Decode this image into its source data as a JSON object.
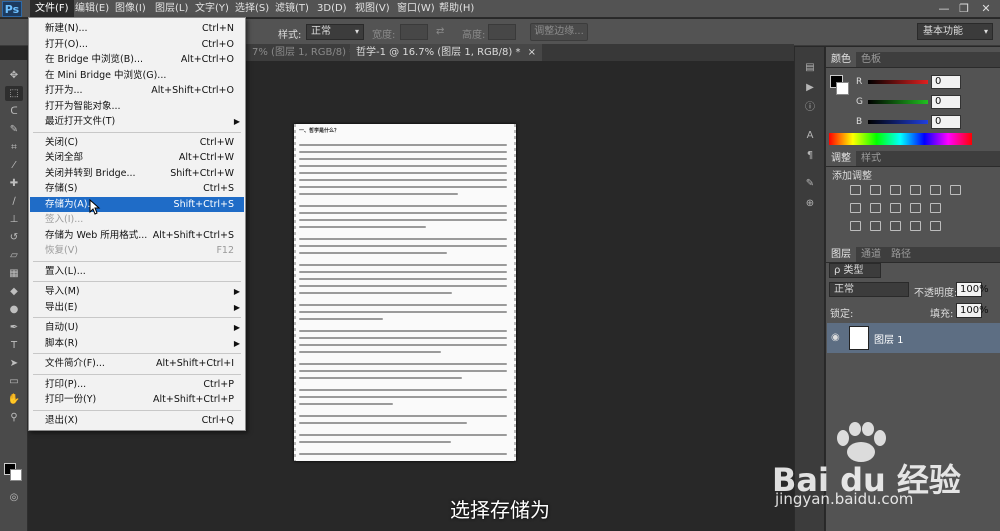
{
  "app": {
    "logo": "Ps"
  },
  "menubar": {
    "items": [
      "文件(F)",
      "编辑(E)",
      "图像(I)",
      "图层(L)",
      "文字(Y)",
      "选择(S)",
      "滤镜(T)",
      "3D(D)",
      "视图(V)",
      "窗口(W)",
      "帮助(H)"
    ]
  },
  "window_controls": {
    "minimize": "—",
    "restore": "❐",
    "close": "✕"
  },
  "options": {
    "style_label": "样式:",
    "style_value": "正常",
    "width_label": "宽度:",
    "height_label": "高度:",
    "refine_edge": "调整边缘..."
  },
  "workspace": {
    "value": "基本功能"
  },
  "tabs": [
    {
      "label": "7% (图层 1, RGB/8) *"
    },
    {
      "label": "哲学-1 @ 16.7% (图层 1, RGB/8) *",
      "close": "×"
    }
  ],
  "document": {
    "heading": "一、哲学是什么？"
  },
  "file_menu": {
    "items": [
      {
        "label": "新建(N)...",
        "shortcut": "Ctrl+N"
      },
      {
        "label": "打开(O)...",
        "shortcut": "Ctrl+O"
      },
      {
        "label": "在 Bridge 中浏览(B)...",
        "shortcut": "Alt+Ctrl+O"
      },
      {
        "label": "在 Mini Bridge 中浏览(G)...",
        "shortcut": ""
      },
      {
        "label": "打开为...",
        "shortcut": "Alt+Shift+Ctrl+O"
      },
      {
        "label": "打开为智能对象...",
        "shortcut": ""
      },
      {
        "label": "最近打开文件(T)",
        "shortcut": "",
        "submenu": true
      },
      {
        "label": "关闭(C)",
        "shortcut": "Ctrl+W"
      },
      {
        "label": "关闭全部",
        "shortcut": "Alt+Ctrl+W"
      },
      {
        "label": "关闭并转到 Bridge...",
        "shortcut": "Shift+Ctrl+W"
      },
      {
        "label": "存储(S)",
        "shortcut": "Ctrl+S"
      },
      {
        "label": "存储为(A)...",
        "shortcut": "Shift+Ctrl+S",
        "highlighted": true
      },
      {
        "label": "签入(I)...",
        "shortcut": "",
        "disabled": true
      },
      {
        "label": "存储为 Web 所用格式...",
        "shortcut": "Alt+Shift+Ctrl+S"
      },
      {
        "label": "恢复(V)",
        "shortcut": "F12",
        "disabled": true
      },
      {
        "label": "置入(L)...",
        "shortcut": ""
      },
      {
        "label": "导入(M)",
        "shortcut": "",
        "submenu": true
      },
      {
        "label": "导出(E)",
        "shortcut": "",
        "submenu": true
      },
      {
        "label": "自动(U)",
        "shortcut": "",
        "submenu": true
      },
      {
        "label": "脚本(R)",
        "shortcut": "",
        "submenu": true
      },
      {
        "label": "文件简介(F)...",
        "shortcut": "Alt+Shift+Ctrl+I"
      },
      {
        "label": "打印(P)...",
        "shortcut": "Ctrl+P"
      },
      {
        "label": "打印一份(Y)",
        "shortcut": "Alt+Shift+Ctrl+P"
      },
      {
        "label": "退出(X)",
        "shortcut": "Ctrl+Q"
      }
    ]
  },
  "color_panel": {
    "tabs": [
      "颜色",
      "色板"
    ],
    "channels": [
      {
        "label": "R",
        "value": "0",
        "color": "#e02020"
      },
      {
        "label": "G",
        "value": "0",
        "color": "#20c020"
      },
      {
        "label": "B",
        "value": "0",
        "color": "#2040e0"
      }
    ]
  },
  "adjust_panel": {
    "tabs": [
      "调整",
      "样式"
    ],
    "title": "添加调整"
  },
  "layers_panel": {
    "tabs": [
      "图层",
      "通道",
      "路径"
    ],
    "filter": "ρ 类型",
    "blend_mode": "正常",
    "opacity_label": "不透明度:",
    "opacity_value": "100%",
    "lock_label": "锁定:",
    "fill_label": "填充:",
    "fill_value": "100%",
    "layer_name": "图层 1"
  },
  "caption": "选择存储为",
  "watermark": {
    "brand": "Bai du 经验",
    "url": "jingyan.baidu.com"
  }
}
